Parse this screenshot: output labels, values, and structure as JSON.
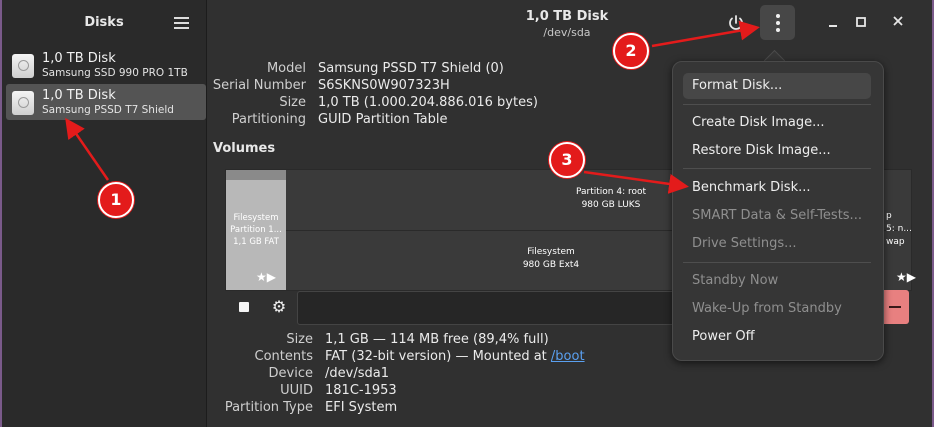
{
  "sidebar": {
    "title": "Disks",
    "disks": [
      {
        "name": "1,0 TB Disk",
        "model": "Samsung SSD 990 PRO 1TB"
      },
      {
        "name": "1,0 TB Disk",
        "model": "Samsung PSSD T7 Shield"
      }
    ]
  },
  "header": {
    "title": "1,0 TB Disk",
    "subtitle": "/dev/sda"
  },
  "disk_info": [
    {
      "label": "Model",
      "value": "Samsung PSSD T7 Shield (0)"
    },
    {
      "label": "Serial Number",
      "value": "S6SKNS0W907323H"
    },
    {
      "label": "Size",
      "value": "1,0 TB (1.000.204.886.016 bytes)"
    },
    {
      "label": "Partitioning",
      "value": "GUID Partition Table"
    }
  ],
  "volumes": {
    "title": "Volumes",
    "partitions": [
      {
        "line1": "Filesystem",
        "line2": "Partition 1...",
        "line3": "1,1 GB FAT"
      },
      {
        "line1": "Partition 4: root",
        "line2": "980 GB LUKS"
      },
      {
        "line1": "Filesystem",
        "line2": "980 GB Ext4"
      },
      {
        "line1": "p",
        "line2": "5: n...",
        "line3": "wap"
      }
    ]
  },
  "partition_info": [
    {
      "label": "Size",
      "value": "1,1 GB — 114 MB free (89,4% full)"
    },
    {
      "label": "Contents",
      "value": "FAT (32-bit version) — Mounted at ",
      "link": "/boot"
    },
    {
      "label": "Device",
      "value": "/dev/sda1"
    },
    {
      "label": "UUID",
      "value": "181C-1953"
    },
    {
      "label": "Partition Type",
      "value": "EFI System"
    }
  ],
  "menu": {
    "items": [
      {
        "label": "Format Disk...",
        "enabled": true
      },
      {
        "label": "Create Disk Image...",
        "enabled": true
      },
      {
        "label": "Restore Disk Image...",
        "enabled": true
      },
      {
        "label": "Benchmark Disk...",
        "enabled": true
      },
      {
        "label": "SMART Data & Self-Tests...",
        "enabled": false
      },
      {
        "label": "Drive Settings...",
        "enabled": false
      },
      {
        "label": "Standby Now",
        "enabled": false
      },
      {
        "label": "Wake-Up from Standby",
        "enabled": false
      },
      {
        "label": "Power Off",
        "enabled": true
      }
    ]
  },
  "icons": {
    "power": "power-icon",
    "kebab": "menu-kebab-icon",
    "hamburger": "hamburger-icon",
    "minimize": "minimize-icon",
    "maximize": "maximize-icon",
    "close": "close-icon",
    "stop": "stop-icon",
    "gear": "gear-icon",
    "star": "star-icon",
    "play": "play-icon",
    "minus": "minus-icon"
  },
  "annotations": [
    "1",
    "2",
    "3"
  ],
  "colors": {
    "annotation": "#e31b1b",
    "link": "#5aa0f0",
    "danger": "#e88080"
  }
}
